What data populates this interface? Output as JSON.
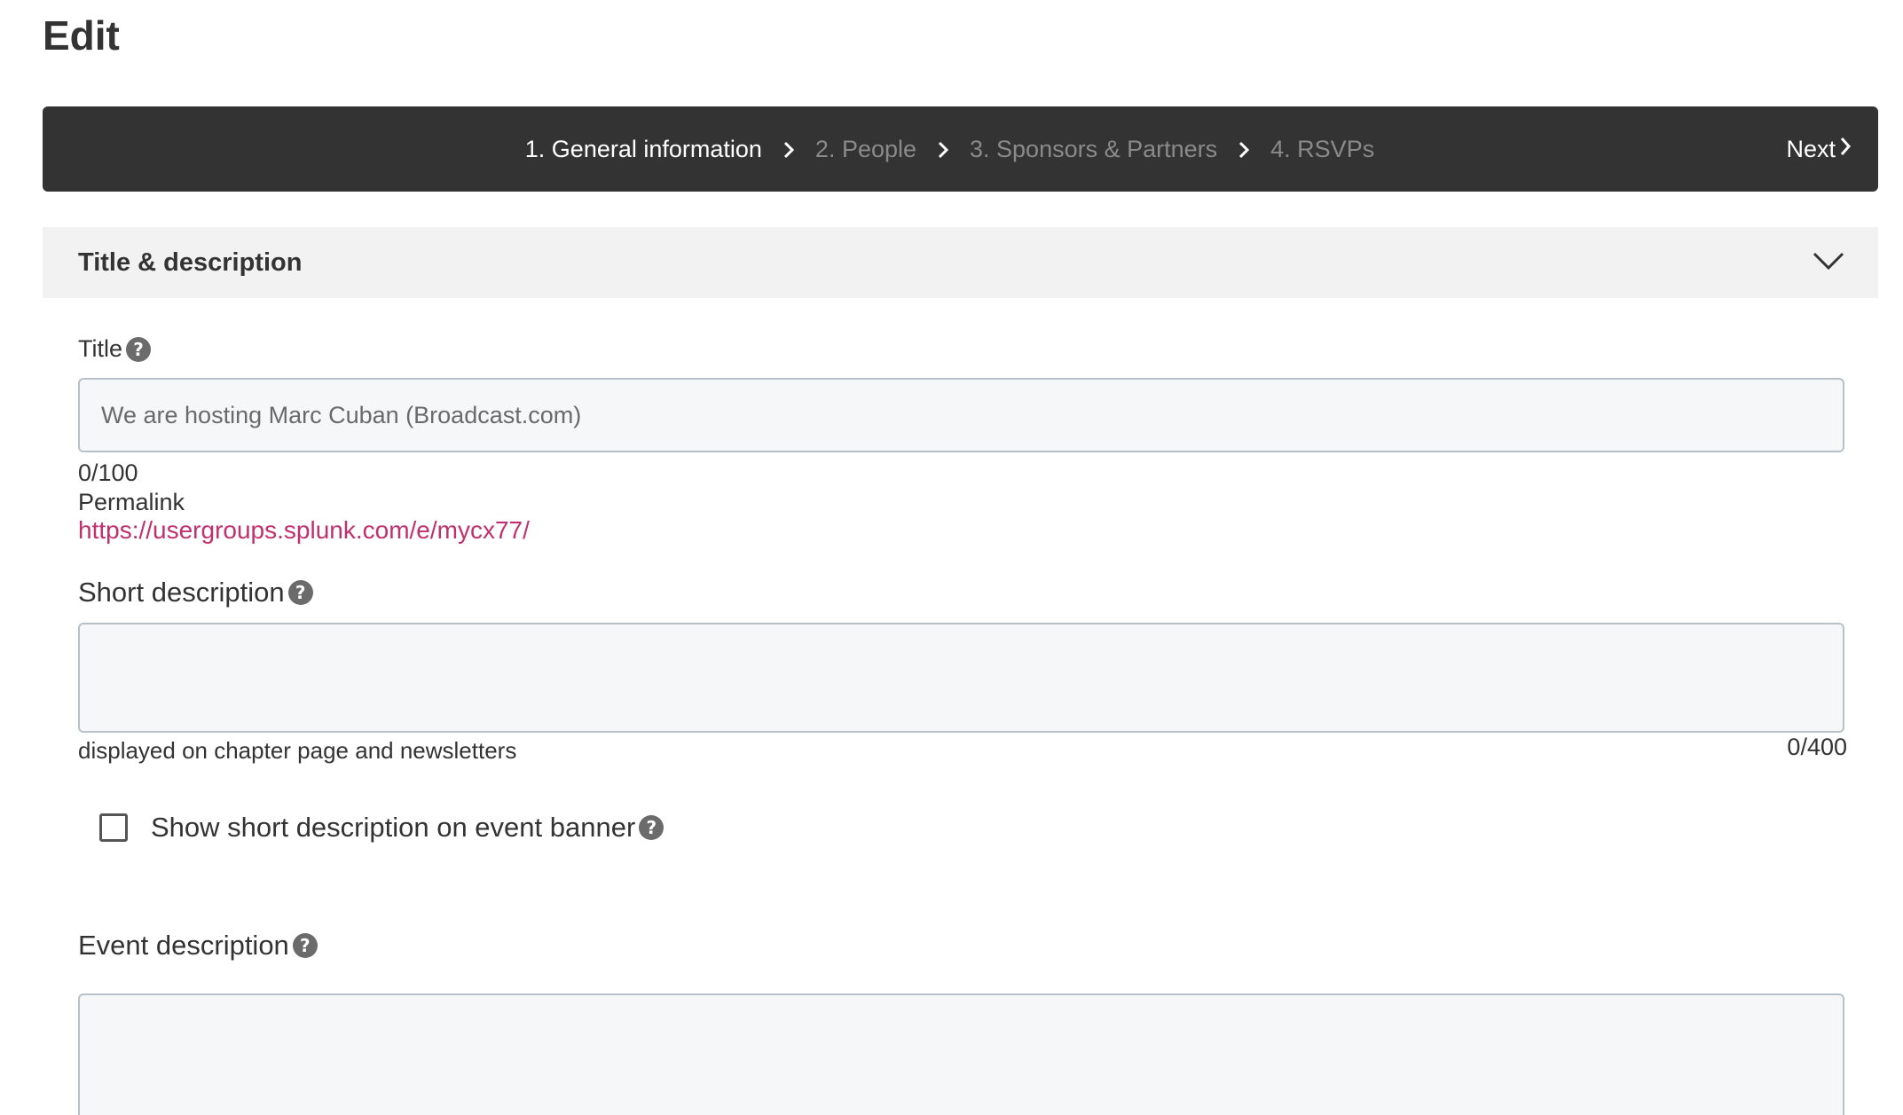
{
  "page": {
    "title": "Edit"
  },
  "stepper": {
    "steps": [
      {
        "label": "1. General information",
        "active": true
      },
      {
        "label": "2. People",
        "active": false
      },
      {
        "label": "3. Sponsors & Partners",
        "active": false
      },
      {
        "label": "4. RSVPs",
        "active": false
      }
    ],
    "next_label": "Next"
  },
  "section": {
    "title": "Title & description"
  },
  "title_field": {
    "label": "Title",
    "placeholder": "We are hosting Marc Cuban (Broadcast.com)",
    "value": "",
    "counter": "0/100"
  },
  "permalink": {
    "label": "Permalink",
    "url": "https://usergroups.splunk.com/e/mycx77/"
  },
  "short_description": {
    "label": "Short description",
    "value": "",
    "hint": "displayed on chapter page and newsletters",
    "counter": "0/400"
  },
  "banner_checkbox": {
    "label": "Show short description on event banner",
    "checked": false
  },
  "event_description": {
    "label": "Event description",
    "value": ""
  },
  "colors": {
    "stepper_bg": "#333333",
    "link": "#c0306e",
    "section_bg": "#f2f2f2"
  },
  "icons": [
    "chevron-right-icon",
    "chevron-down-icon",
    "help-icon"
  ]
}
